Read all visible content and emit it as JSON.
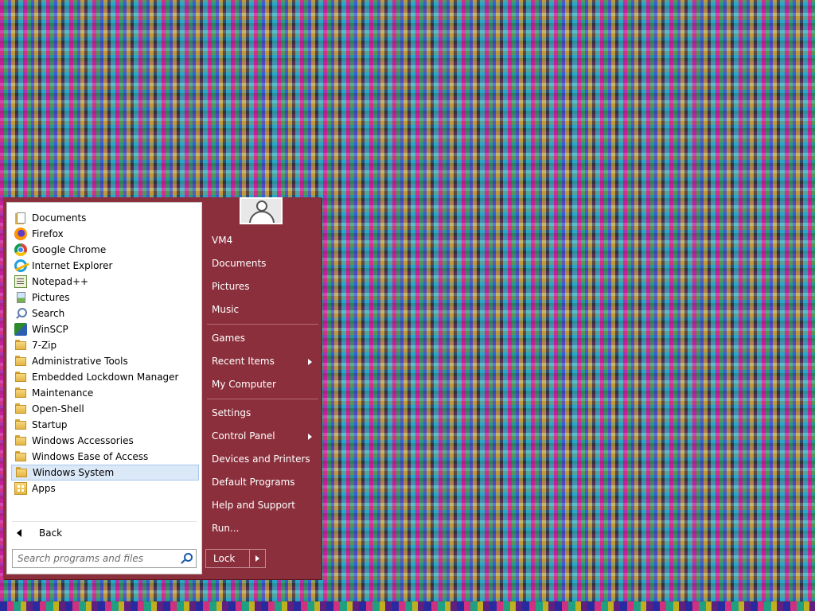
{
  "programs": [
    {
      "label": "Documents",
      "icon": "documents-icon"
    },
    {
      "label": "Firefox",
      "icon": "firefox-icon"
    },
    {
      "label": "Google Chrome",
      "icon": "chrome-icon"
    },
    {
      "label": "Internet Explorer",
      "icon": "internet-explorer-icon"
    },
    {
      "label": "Notepad++",
      "icon": "notepad-plus-plus-icon"
    },
    {
      "label": "Pictures",
      "icon": "pictures-icon"
    },
    {
      "label": "Search",
      "icon": "search-icon"
    },
    {
      "label": "WinSCP",
      "icon": "winscp-icon"
    },
    {
      "label": "7-Zip",
      "icon": "folder-icon"
    },
    {
      "label": "Administrative Tools",
      "icon": "folder-icon"
    },
    {
      "label": "Embedded Lockdown Manager",
      "icon": "folder-icon"
    },
    {
      "label": "Maintenance",
      "icon": "folder-icon"
    },
    {
      "label": "Open-Shell",
      "icon": "folder-icon"
    },
    {
      "label": "Startup",
      "icon": "folder-icon"
    },
    {
      "label": "Windows Accessories",
      "icon": "folder-icon"
    },
    {
      "label": "Windows Ease of Access",
      "icon": "folder-icon"
    },
    {
      "label": "Windows System",
      "icon": "folder-icon",
      "selected": true
    },
    {
      "label": "Apps",
      "icon": "apps-folder-icon"
    }
  ],
  "back_label": "Back",
  "search": {
    "placeholder": "Search programs and files"
  },
  "right_menu": {
    "user": "VM4",
    "documents": "Documents",
    "pictures": "Pictures",
    "music": "Music",
    "games": "Games",
    "recent_items": "Recent Items",
    "my_computer": "My Computer",
    "settings": "Settings",
    "control_panel": "Control Panel",
    "devices_printers": "Devices and Printers",
    "default_programs": "Default Programs",
    "help_support": "Help and Support",
    "run": "Run..."
  },
  "lock_label": "Lock",
  "colors": {
    "menu_background": "#8b2f3c",
    "selection": "#dbe8f8"
  }
}
